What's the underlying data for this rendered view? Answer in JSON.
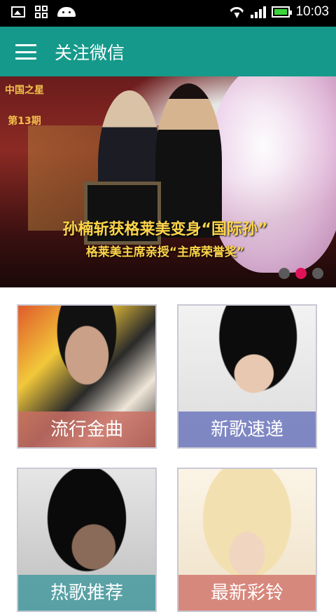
{
  "status_bar": {
    "time": "10:03",
    "colors": {
      "battery": "#39d53a",
      "background": "#000000"
    }
  },
  "app_bar": {
    "title": "关注微信",
    "background": "#15998a"
  },
  "banner": {
    "badge_logo": "中国之星",
    "badge_issue": "第13期",
    "headline": "孙楠斩获格莱美变身“国际孙”",
    "subheadline": "格莱美主席亲授“主席荣誉奖”",
    "pager": {
      "count": 3,
      "active_index": 1,
      "active_color": "#e0125a"
    }
  },
  "tiles": [
    {
      "label": "流行金曲"
    },
    {
      "label": "新歌速递"
    },
    {
      "label": "热歌推荐"
    },
    {
      "label": "最新彩铃"
    }
  ]
}
